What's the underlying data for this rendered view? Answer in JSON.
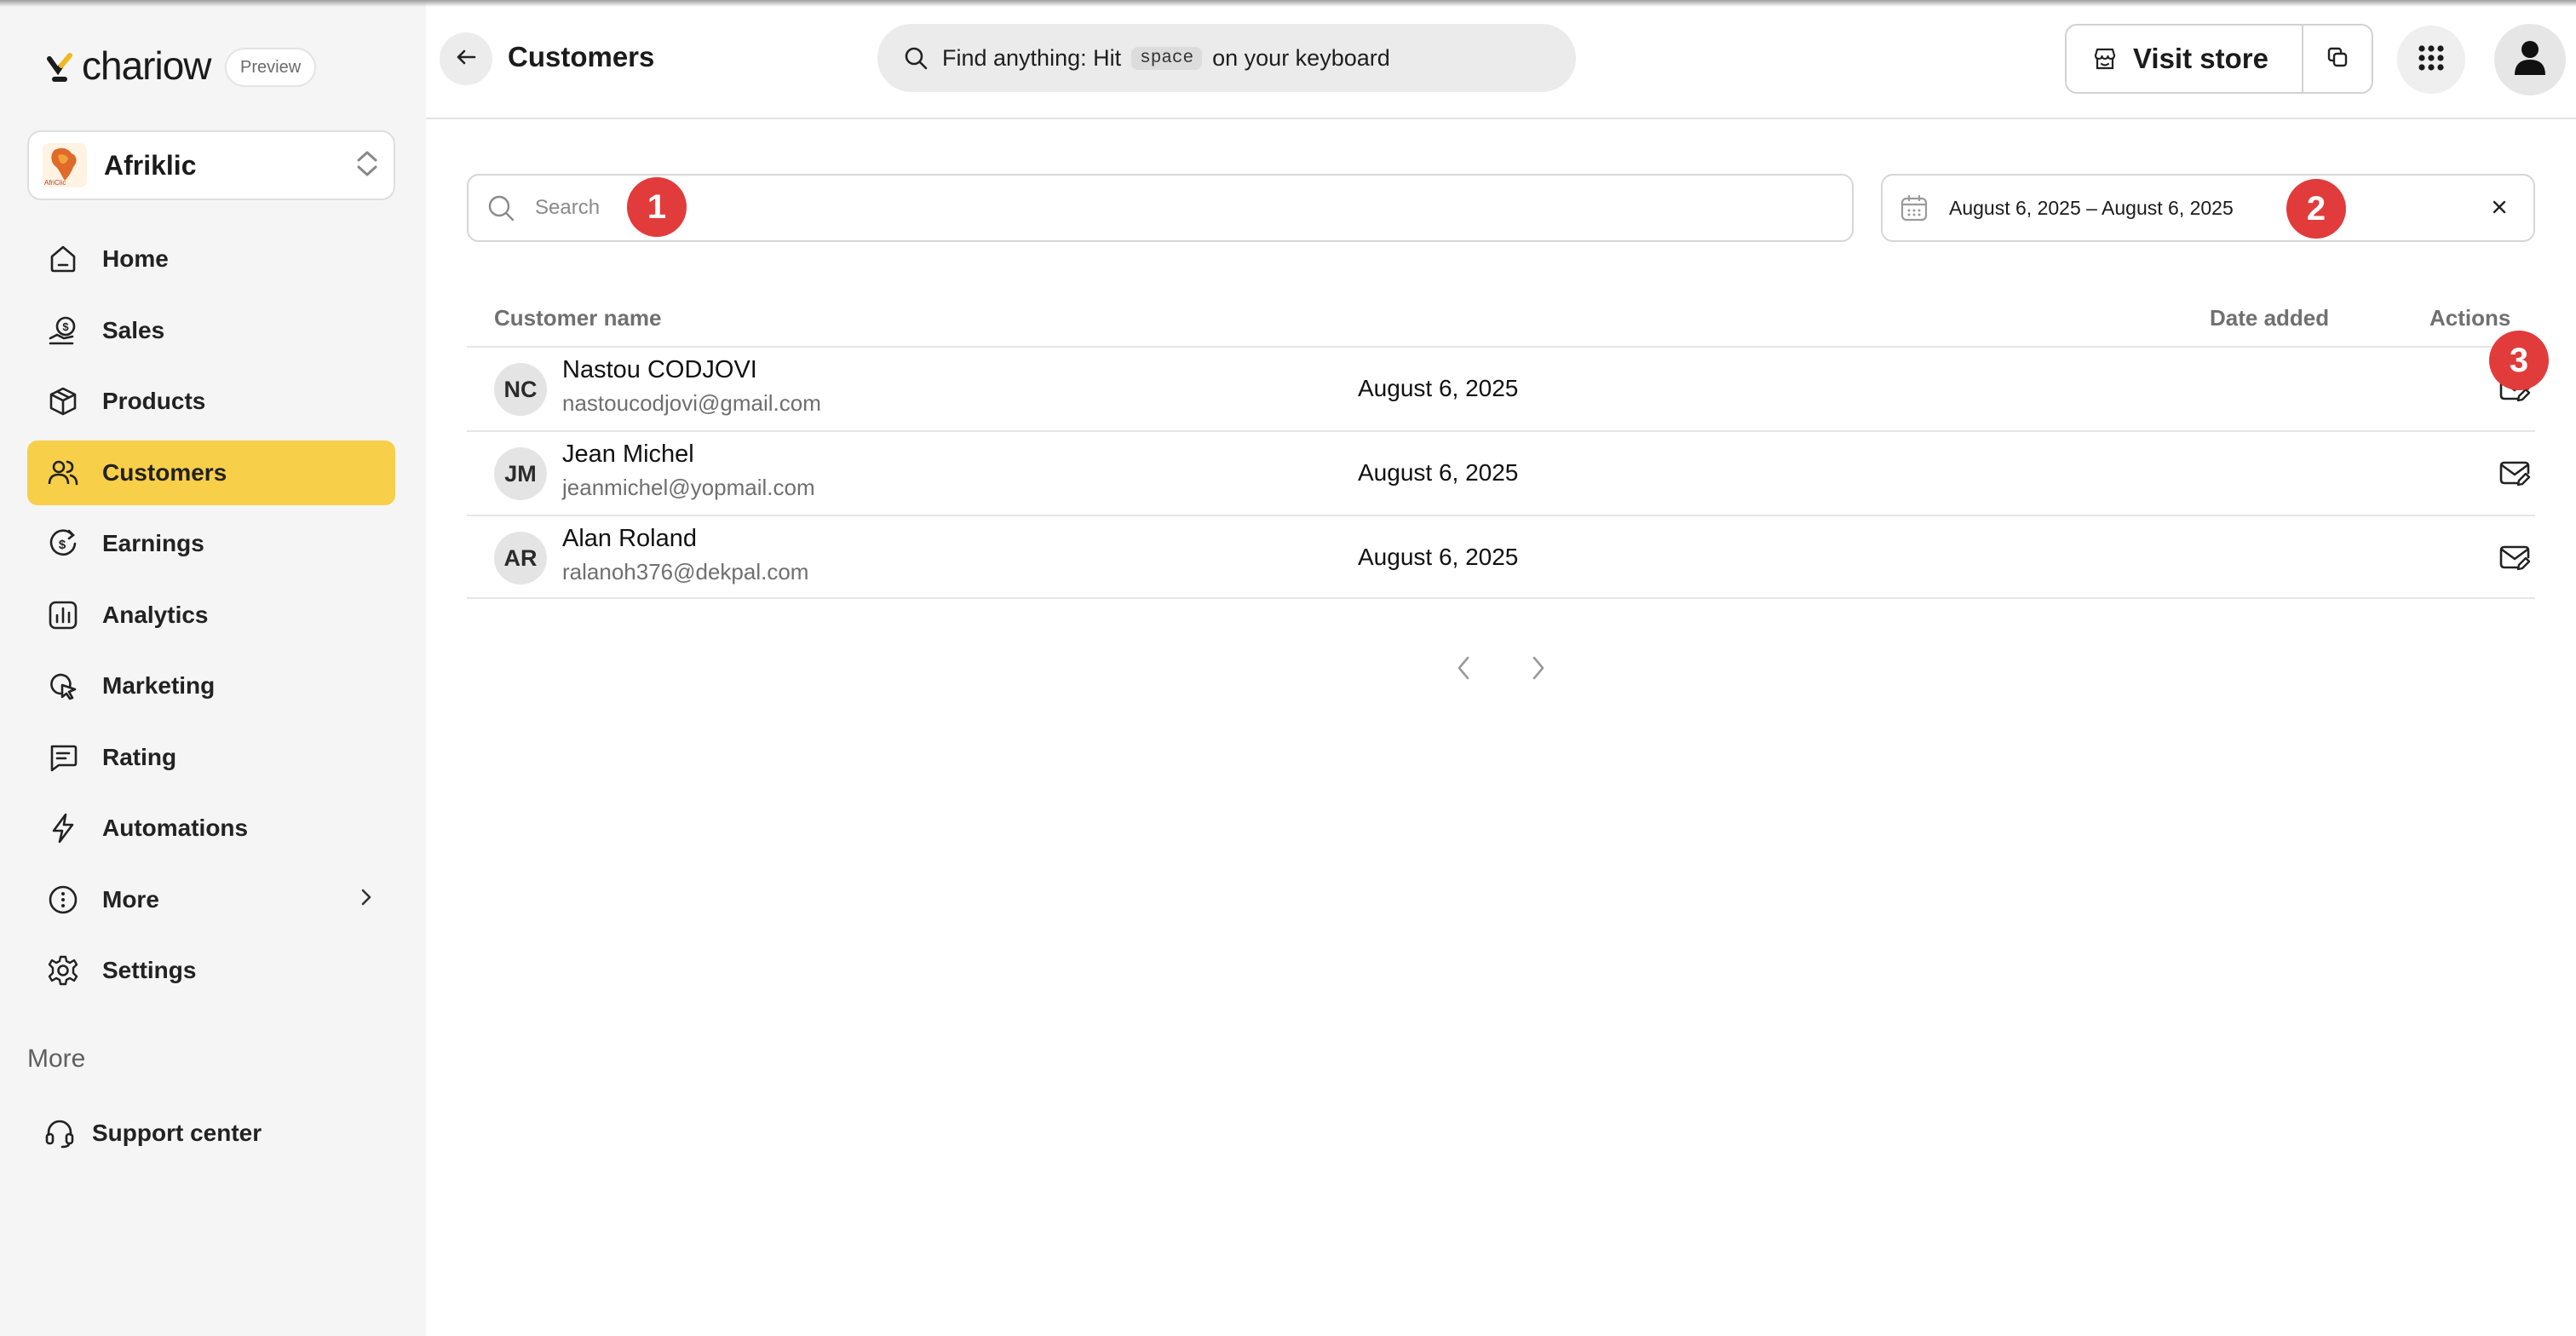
{
  "app": {
    "brand": "chariow",
    "preview_badge": "Preview"
  },
  "store": {
    "name": "Afriklic",
    "avatar_caption": "AfriClic"
  },
  "sidebar": {
    "items": [
      {
        "label": "Home",
        "icon": "home-icon"
      },
      {
        "label": "Sales",
        "icon": "sales-icon"
      },
      {
        "label": "Products",
        "icon": "box-icon"
      },
      {
        "label": "Customers",
        "icon": "users-icon",
        "active": true
      },
      {
        "label": "Earnings",
        "icon": "earnings-icon"
      },
      {
        "label": "Analytics",
        "icon": "chart-icon"
      },
      {
        "label": "Marketing",
        "icon": "cursor-icon"
      },
      {
        "label": "Rating",
        "icon": "message-icon"
      },
      {
        "label": "Automations",
        "icon": "bolt-icon"
      },
      {
        "label": "More",
        "icon": "dots-circle-icon"
      },
      {
        "label": "Settings",
        "icon": "gear-icon"
      }
    ],
    "more_heading": "More",
    "support_label": "Support center"
  },
  "header": {
    "title": "Customers",
    "search_prefix": "Find anything: Hit",
    "search_key": "space",
    "search_suffix": "on your keyboard",
    "visit_store": "Visit store"
  },
  "filters": {
    "search_placeholder": "Search",
    "date_range": "August 6, 2025 – August 6, 2025"
  },
  "annotations": [
    "1",
    "2",
    "3"
  ],
  "table": {
    "columns": {
      "name": "Customer name",
      "date": "Date added",
      "actions": "Actions"
    },
    "rows": [
      {
        "initials": "NC",
        "name": "Nastou CODJOVI",
        "email": "nastoucodjovi@gmail.com",
        "date": "August 6, 2025"
      },
      {
        "initials": "JM",
        "name": "Jean Michel",
        "email": "jeanmichel@yopmail.com",
        "date": "August 6, 2025"
      },
      {
        "initials": "AR",
        "name": "Alan Roland",
        "email": "ralanoh376@dekpal.com",
        "date": "August 6, 2025"
      }
    ]
  },
  "colors": {
    "accent": "#f8cf48",
    "annotation": "#e23b3b",
    "sidebar_bg": "#f5f5f5"
  }
}
